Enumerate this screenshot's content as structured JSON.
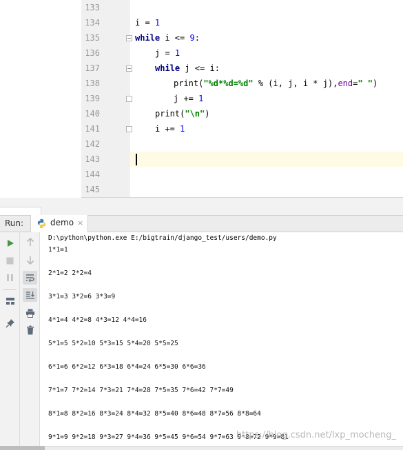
{
  "editor": {
    "line_numbers": [
      "133",
      "134",
      "135",
      "136",
      "137",
      "138",
      "139",
      "140",
      "141",
      "142",
      "143",
      "144",
      "145"
    ],
    "current_line": "143"
  },
  "code": {
    "l134": {
      "a": "i = ",
      "b": "1"
    },
    "l135": {
      "kw": "while",
      "a": " i <= ",
      "b": "9",
      "c": ":"
    },
    "l136": {
      "a": "j = ",
      "b": "1"
    },
    "l137": {
      "kw": "while",
      "a": " j <= i:"
    },
    "l138": {
      "a": "print(",
      "s": "\"%d*%d=%d\"",
      "b": " % (i, j, i * j),",
      "k": "end",
      "c": "=",
      "s2": "\" \"",
      "d": ")"
    },
    "l139": {
      "a": "j += ",
      "b": "1"
    },
    "l140": {
      "a": "print(",
      "s": "\"\\n\"",
      "b": ")"
    },
    "l141": {
      "a": "i += ",
      "b": "1"
    }
  },
  "run_panel": {
    "label": "Run:",
    "tab_label": "demo",
    "close_icon": "×"
  },
  "console": {
    "command": "D:\\python\\python.exe E:/bigtrain/django_test/users/demo.py",
    "lines": [
      "1*1=1",
      "2*1=2 2*2=4",
      "3*1=3 3*2=6 3*3=9",
      "4*1=4 4*2=8 4*3=12 4*4=16",
      "5*1=5 5*2=10 5*3=15 5*4=20 5*5=25",
      "6*1=6 6*2=12 6*3=18 6*4=24 6*5=30 6*6=36",
      "7*1=7 7*2=14 7*3=21 7*4=28 7*5=35 7*6=42 7*7=49",
      "8*1=8 8*2=16 8*3=24 8*4=32 8*5=40 8*6=48 8*7=56 8*8=64",
      "9*1=9 9*2=18 9*3=27 9*4=36 9*5=45 9*6=54 9*7=63 9*8=72 9*9=81"
    ]
  },
  "watermark": "https://blog.csdn.net/lxp_mocheng_",
  "colors": {
    "keyword": "#000080",
    "number": "#0000ff",
    "string": "#008000",
    "kwarg": "#660099",
    "run_green": "#3d9a3d",
    "current_line_bg": "#fffae3"
  }
}
